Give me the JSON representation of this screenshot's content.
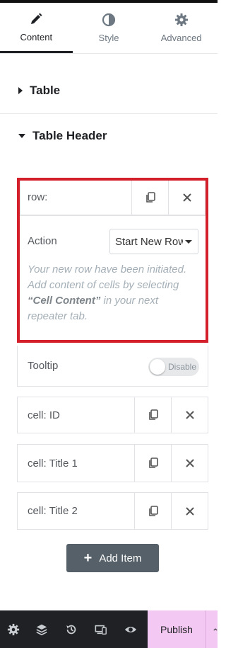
{
  "tabs": [
    {
      "label": "Content",
      "icon": "pencil-icon",
      "active": true
    },
    {
      "label": "Style",
      "icon": "half-circle-icon",
      "active": false
    },
    {
      "label": "Advanced",
      "icon": "gear-icon",
      "active": false
    }
  ],
  "sections": {
    "table": {
      "label": "Table"
    },
    "table_header": {
      "label": "Table Header"
    }
  },
  "row_item": {
    "title": "row:",
    "action_label": "Action",
    "action_value": "Start New Row",
    "note_prefix": "Your new row have been initiated. Add content of cells by selecting ",
    "note_bold": "“Cell Content”",
    "note_suffix": " in your next repeater tab."
  },
  "tooltip": {
    "label": "Tooltip",
    "toggle_text": "Disable"
  },
  "cells": [
    {
      "title": "cell: ID"
    },
    {
      "title": "cell: Title 1"
    },
    {
      "title": "cell: Title 2"
    }
  ],
  "add_item": {
    "label": "Add Item"
  },
  "footer": {
    "icons": [
      "gear-icon",
      "layers-icon",
      "history-icon",
      "responsive-icon",
      "eye-icon"
    ],
    "publish_label": "Publish"
  },
  "colors": {
    "highlight": "#d3202b",
    "publish": "#f3c8f3",
    "footer": "#1f2124"
  }
}
